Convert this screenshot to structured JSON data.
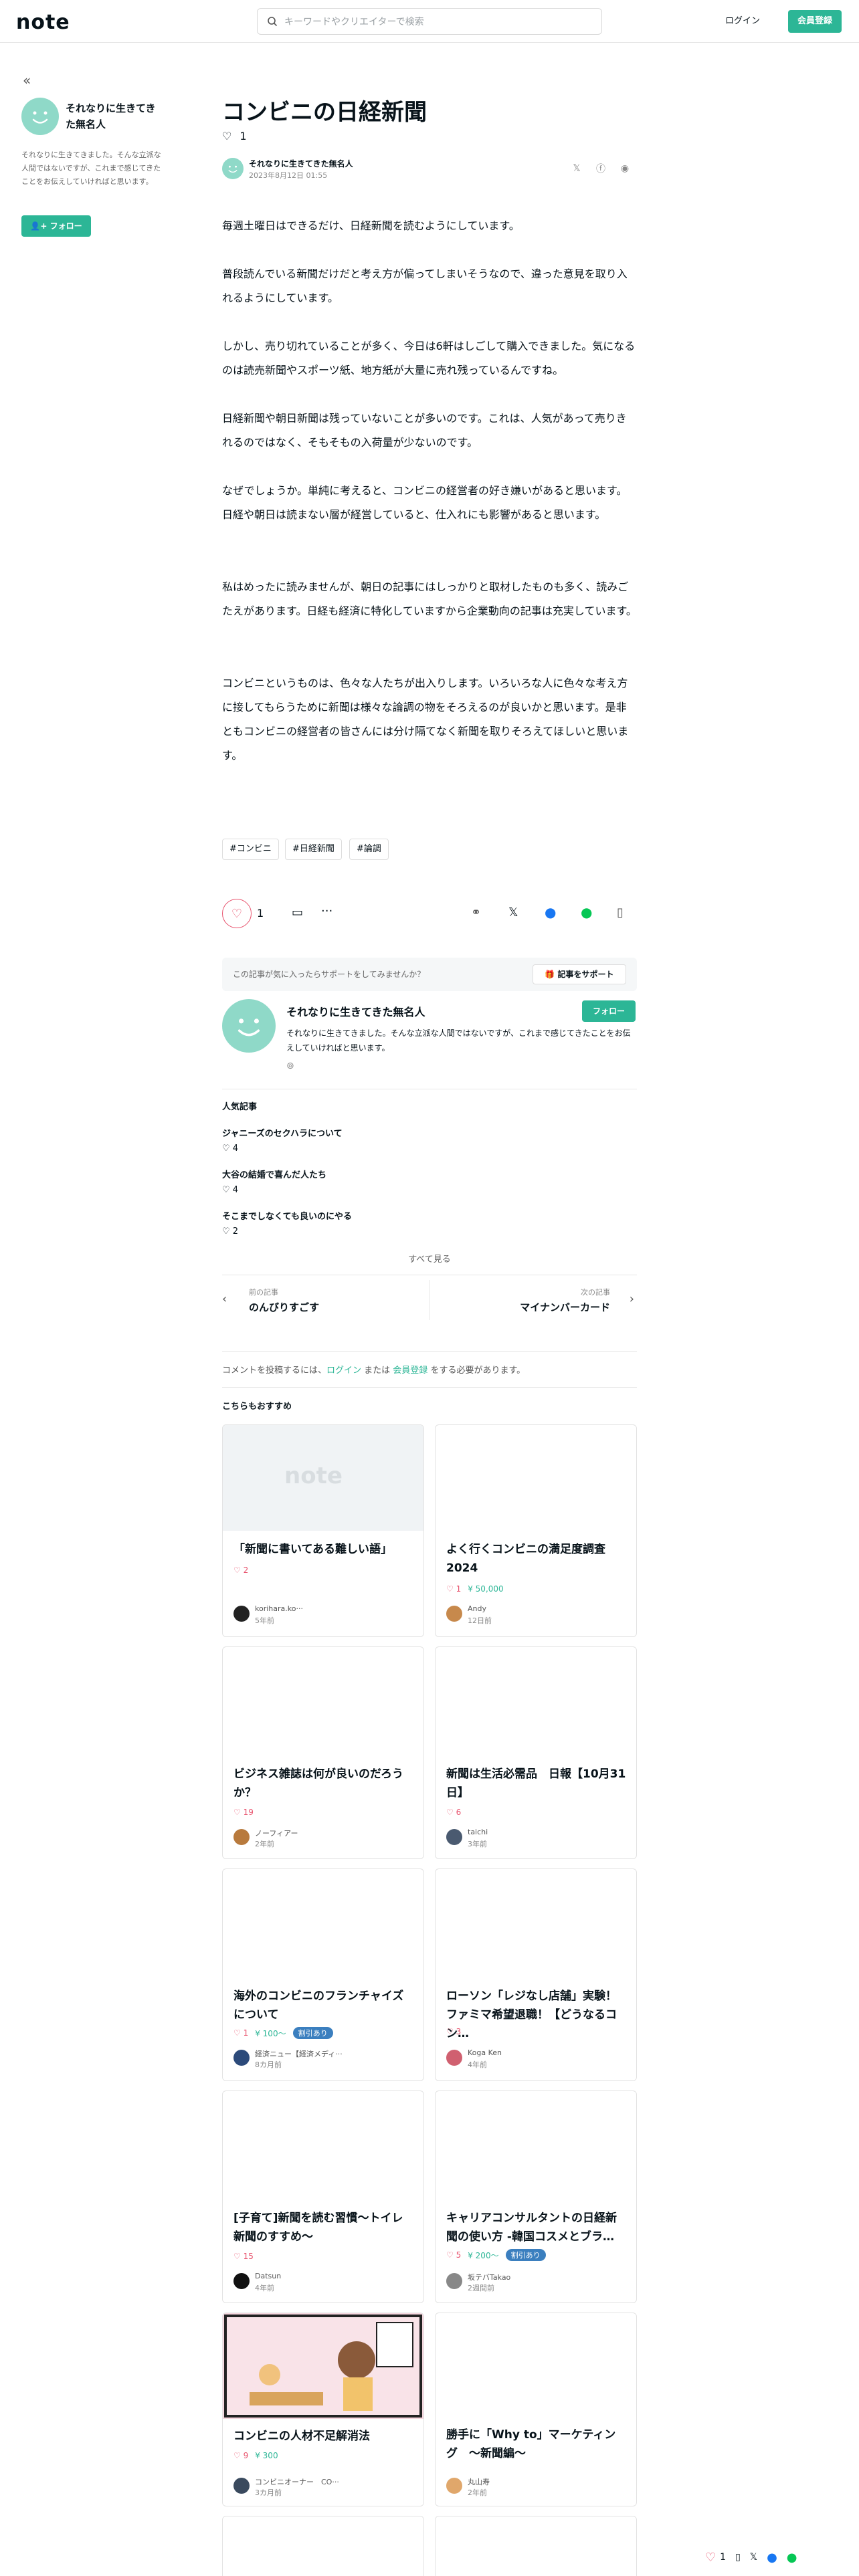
{
  "header": {
    "logo": "note",
    "search_placeholder": "キーワードやクリエイターで検索",
    "login": "ログイン",
    "signup": "会員登録"
  },
  "sidebar": {
    "author_name": "それなりに生きてきた無名人",
    "bio": "それなりに生きてきました。そんな立派な人間ではないですが、これまで感じてきたことをお伝えしていければと思います。",
    "follow": "フォロー"
  },
  "article": {
    "title": "コンビニの日経新聞",
    "likes": "1",
    "author": "それなりに生きてきた無名人",
    "date": "2023年8月12日 01:55",
    "paragraphs": [
      "毎週土曜日はできるだけ、日経新聞を読むようにしています。",
      "普段読んでいる新聞だけだと考え方が偏ってしまいそうなので、違った意見を取り入れるようにしています。",
      "しかし、売り切れていることが多く、今日は6軒はしごして購入できました。気になるのは読売新聞やスポーツ紙、地方紙が大量に売れ残っているんですね。",
      "日経新聞や朝日新聞は残っていないことが多いのです。これは、人気があって売りきれるのではなく、そもそもの入荷量が少ないのです。",
      "なぜでしょうか。単純に考えると、コンビニの経営者の好き嫌いがあると思います。日経や朝日は読まない層が経営していると、仕入れにも影響があると思います。",
      "私はめったに読みませんが、朝日の記事にはしっかりと取材したものも多く、読みごたえがあります。日経も経済に特化していますから企業動向の記事は充実しています。",
      "コンビニというものは、色々な人たちが出入りします。いろいろな人に色々な考え方に接してもらうために新聞は様々な論調の物をそろえるのが良いかと思います。是非ともコンビニの経営者の皆さんには分け隔てなく新聞を取りそろえてほしいと思います。"
    ],
    "tags": [
      "#コンビニ",
      "#日経新聞",
      "#論調"
    ],
    "like_count": "1"
  },
  "support": {
    "text": "この記事が気に入ったらサポートをしてみませんか？",
    "button": "記事をサポート"
  },
  "creator_card": {
    "name": "それなりに生きてきた無名人",
    "bio": "それなりに生きてきました。そんな立派な人間ではないですが、これまで感じてきたことをお伝えしていければと思います。",
    "follow": "フォロー"
  },
  "popular": {
    "heading": "人気記事",
    "items": [
      {
        "title": "ジャニーズのセクハラについて",
        "likes": "4"
      },
      {
        "title": "大谷の結婚で喜んだ人たち",
        "likes": "4"
      },
      {
        "title": "そこまでしなくても良いのにやる",
        "likes": "2"
      }
    ],
    "see_all": "すべて見る"
  },
  "nav": {
    "prev_label": "前の記事",
    "prev_title": "のんびりすごす",
    "next_label": "次の記事",
    "next_title": "マイナンバーカード"
  },
  "comment": {
    "prefix": "コメントを投稿するには、",
    "login": "ログイン",
    "or": " または ",
    "register": "会員登録",
    "suffix": " をする必要があります。"
  },
  "recommend": {
    "heading": "こちらもおすすめ",
    "cards": [
      {
        "title": "「新聞に書いてある難しい語」",
        "likes": "2",
        "price": "",
        "badge": "",
        "author": "korihara.ko···",
        "time": "5年前"
      },
      {
        "title": "よく行くコンビニの満足度調査2024",
        "likes": "1",
        "price": "50,000",
        "badge": "",
        "author": "Andy",
        "time": "12日前"
      },
      {
        "title": "ビジネス雑誌は何が良いのだろうか？",
        "likes": "19",
        "price": "",
        "badge": "",
        "author": "ノーフィアー",
        "time": "2年前"
      },
      {
        "title": "新聞は生活必需品　日報【10月31日】",
        "likes": "6",
        "price": "",
        "badge": "",
        "author": "taichi",
        "time": "3年前"
      },
      {
        "title": "海外のコンビニのフランチャイズについて",
        "likes": "1",
        "price": "100〜",
        "badge": "割引あり",
        "author": "経済ニュー【経済メディ···",
        "time": "8カ月前"
      },
      {
        "title": "ローソン「レジなし店舗」実験！ファミマ希望退職！【どうなるコン…",
        "likes": "3",
        "price": "",
        "badge": "",
        "author": "Koga Ken",
        "time": "4年前"
      },
      {
        "title": "[子育て]新聞を読む習慣〜トイレ新聞のすすめ〜",
        "likes": "15",
        "price": "",
        "badge": "",
        "author": "Datsun",
        "time": "4年前"
      },
      {
        "title": "キャリアコンサルタントの日経新聞の使い方 -韓国コスメとブラ…",
        "likes": "5",
        "price": "200〜",
        "badge": "割引あり",
        "author": "坂テバTakao",
        "time": "2週間前"
      },
      {
        "title": "コンビニの人材不足解消法",
        "likes": "9",
        "price": "300",
        "badge": "",
        "author": "コンビニオーナー　CO···",
        "time": "3カ月前"
      },
      {
        "title": "勝手に「Why to」マーケティング　〜新聞編〜",
        "likes": "",
        "price": "",
        "badge": "",
        "author": "丸山寿",
        "time": "2年前"
      }
    ]
  },
  "floating": {
    "likes": "1"
  }
}
